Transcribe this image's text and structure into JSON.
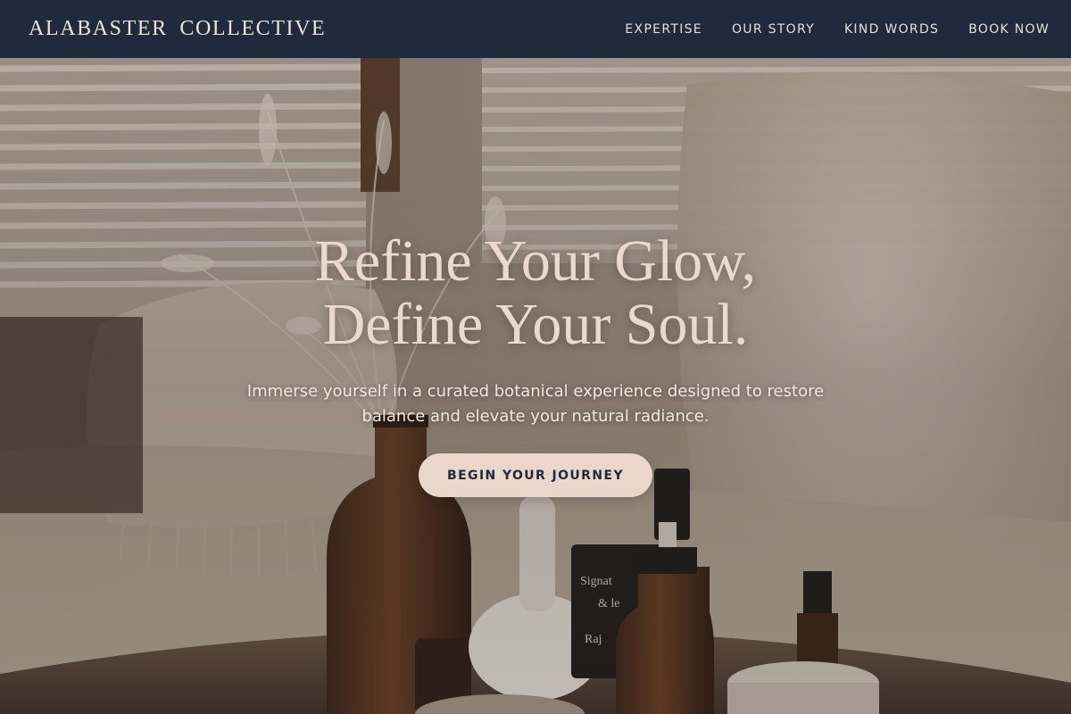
{
  "navbar": {
    "brand": "ALABASTER COLLECTIVE",
    "links": [
      "EXPERTISE",
      "OUR STORY",
      "KIND WORDS",
      "BOOK NOW"
    ]
  },
  "hero": {
    "title_line1": "Refine Your Glow,",
    "title_line2": "Define Your Soul.",
    "subtitle": "Immerse yourself in a curated botanical experience designed to restore balance and elevate your natural radiance.",
    "cta_label": "BEGIN YOUR JOURNEY",
    "background": "spa-interior-photo"
  },
  "colors": {
    "navbar_bg": "#1f2a3c",
    "accent": "#e8d7ca",
    "title_text": "#ead9cc",
    "button_text": "#1f2a3c"
  }
}
